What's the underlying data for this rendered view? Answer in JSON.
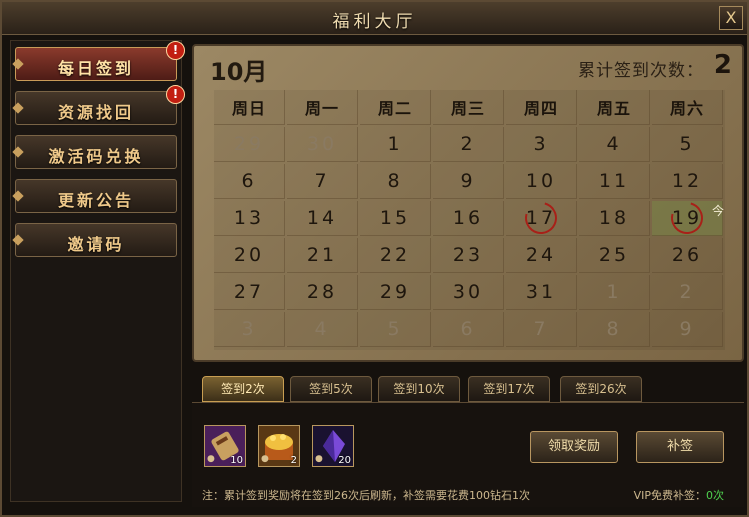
{
  "title": "福利大厅",
  "close_label": "X",
  "sidebar": {
    "items": [
      {
        "label": "每日签到",
        "alert": "!"
      },
      {
        "label": "资源找回",
        "alert": "!"
      },
      {
        "label": "激活码兑换"
      },
      {
        "label": "更新公告"
      },
      {
        "label": "邀请码"
      }
    ]
  },
  "calendar": {
    "month": "10月",
    "signed_label": "累计签到次数：",
    "signed_count": "2",
    "weekdays": [
      "周日",
      "周一",
      "周二",
      "周三",
      "周四",
      "周五",
      "周六"
    ],
    "weeks": [
      [
        "29",
        "30",
        "1",
        "2",
        "3",
        "4",
        "5"
      ],
      [
        "6",
        "7",
        "8",
        "9",
        "10",
        "11",
        "12"
      ],
      [
        "13",
        "14",
        "15",
        "16",
        "17",
        "18",
        "19"
      ],
      [
        "20",
        "21",
        "22",
        "23",
        "24",
        "25",
        "26"
      ],
      [
        "27",
        "28",
        "29",
        "30",
        "31",
        "1",
        "2"
      ],
      [
        "3",
        "4",
        "5",
        "6",
        "7",
        "8",
        "9"
      ]
    ],
    "today_label": "今",
    "signed_days": [
      "17",
      "19"
    ],
    "today": "19"
  },
  "tabs": [
    "签到2次",
    "签到5次",
    "签到10次",
    "签到17次",
    "签到26次"
  ],
  "rewards": {
    "items": [
      {
        "icon": "scroll-reward-icon",
        "qty": "10"
      },
      {
        "icon": "gold-chest-reward-icon",
        "qty": "2"
      },
      {
        "icon": "purple-crystal-reward-icon",
        "qty": "20"
      }
    ],
    "claim_label": "领取奖励",
    "makeup_label": "补签",
    "note": "注：累计签到奖励将在签到26次后刷新，补签需要花费100钻石1次",
    "vip_label": "VIP免费补签：",
    "vip_count": "0",
    "vip_unit": "次"
  }
}
